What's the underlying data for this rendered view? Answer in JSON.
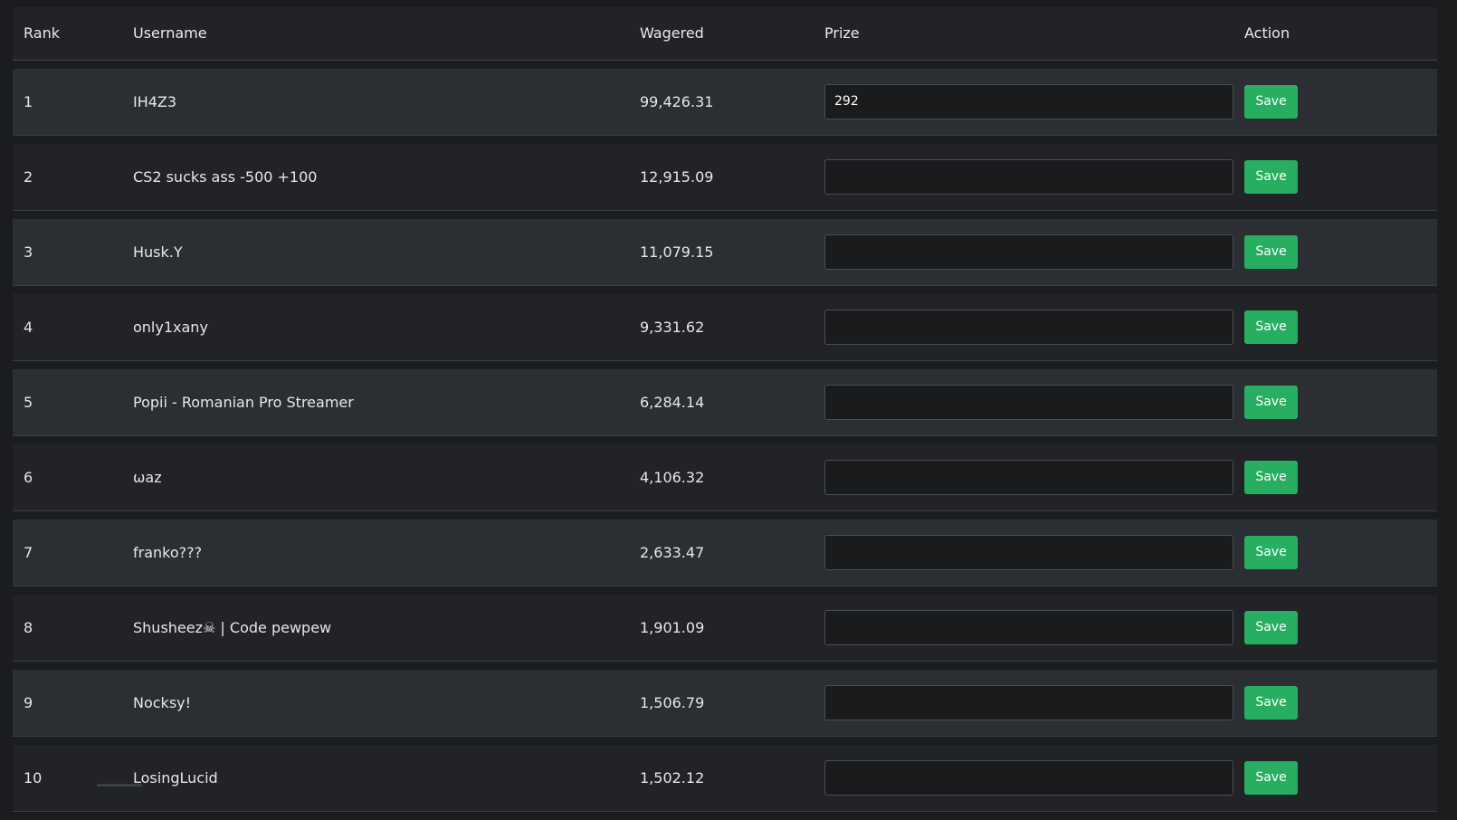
{
  "table": {
    "headers": {
      "rank": "Rank",
      "username": "Username",
      "wagered": "Wagered",
      "prize": "Prize",
      "action": "Action"
    },
    "rows": [
      {
        "rank": "1",
        "username": "IH4Z3",
        "wagered": "99,426.31",
        "prize": "292",
        "action": "Save"
      },
      {
        "rank": "2",
        "username": "CS2 sucks ass -500 +100",
        "wagered": "12,915.09",
        "prize": "",
        "action": "Save"
      },
      {
        "rank": "3",
        "username": "Husk.Y",
        "wagered": "11,079.15",
        "prize": "",
        "action": "Save"
      },
      {
        "rank": "4",
        "username": "only1xany",
        "wagered": "9,331.62",
        "prize": "",
        "action": "Save"
      },
      {
        "rank": "5",
        "username": "Popii - Romanian Pro Streamer",
        "wagered": "6,284.14",
        "prize": "",
        "action": "Save"
      },
      {
        "rank": "6",
        "username": "ωaz",
        "wagered": "4,106.32",
        "prize": "",
        "action": "Save"
      },
      {
        "rank": "7",
        "username": "franko???",
        "wagered": "2,633.47",
        "prize": "",
        "action": "Save"
      },
      {
        "rank": "8",
        "username": "Shusheez☠ | Code pewpew",
        "wagered": "1,901.09",
        "prize": "",
        "action": "Save"
      },
      {
        "rank": "9",
        "username": "Nocksy!",
        "wagered": "1,506.79",
        "prize": "",
        "action": "Save"
      },
      {
        "rank": "10",
        "username": "LosingLucid",
        "wagered": "1,502.12",
        "prize": "",
        "action": "Save"
      }
    ]
  },
  "colors": {
    "background": "#1b1c1e",
    "row_odd": "#2b2e33",
    "row_even": "#222326",
    "save_button": "#27ae60",
    "input_background": "#1a1b1d"
  }
}
